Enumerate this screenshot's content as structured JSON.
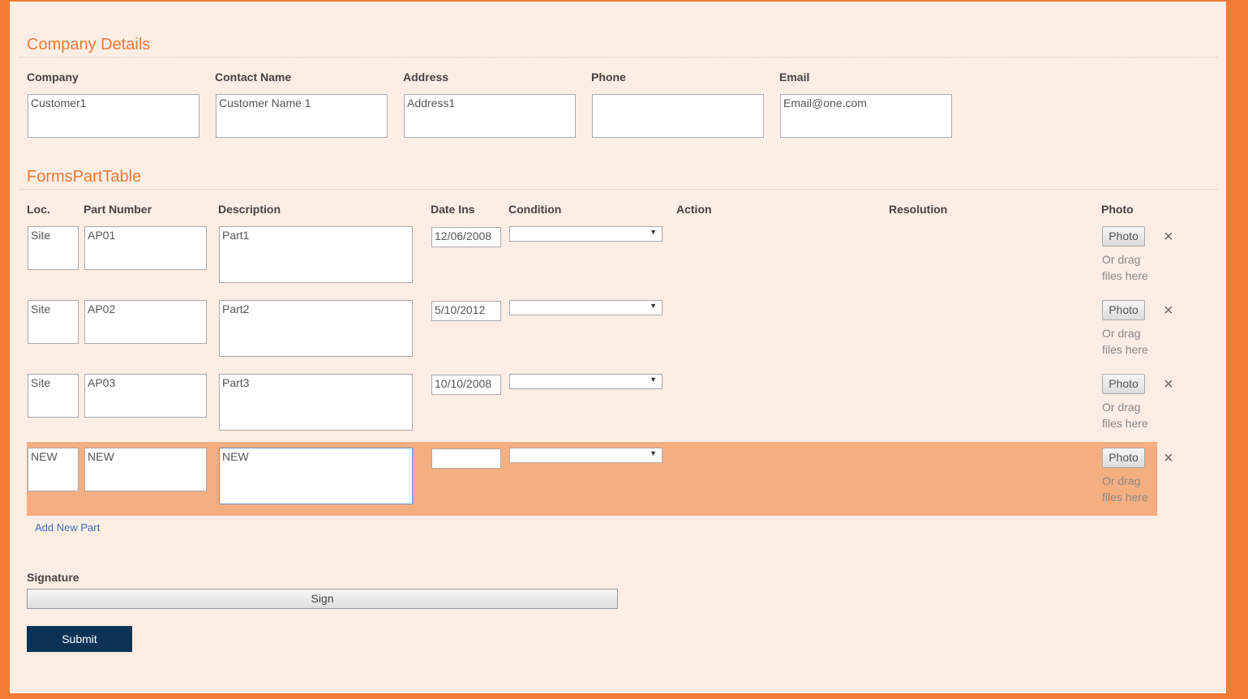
{
  "company_section": {
    "title": "Company Details",
    "fields": [
      {
        "label": "Company",
        "value": "Customer1"
      },
      {
        "label": "Contact Name",
        "value": "Customer Name 1"
      },
      {
        "label": "Address",
        "value": "Address1"
      },
      {
        "label": "Phone",
        "value": ""
      },
      {
        "label": "Email",
        "value": "Email@one.com"
      }
    ]
  },
  "parts_section": {
    "title": "FormsPartTable",
    "columns": [
      "Loc.",
      "Part Number",
      "Description",
      "Date Ins",
      "Condition",
      "Action",
      "Resolution",
      "Photo"
    ],
    "rows": [
      {
        "loc": "Site",
        "part": "AP01",
        "desc": "Part1",
        "date": "12/06/2008",
        "condition": ""
      },
      {
        "loc": "Site",
        "part": "AP02",
        "desc": "Part2",
        "date": "5/10/2012",
        "condition": ""
      },
      {
        "loc": "Site",
        "part": "AP03",
        "desc": "Part3",
        "date": "10/10/2008",
        "condition": ""
      },
      {
        "loc": "NEW",
        "part": "NEW",
        "desc": "NEW",
        "date": "",
        "condition": ""
      }
    ],
    "photo_button": "Photo",
    "drag_text_1": "Or drag",
    "drag_text_2": "files here",
    "remove_icon": "×",
    "add_link": "Add New Part"
  },
  "signature": {
    "label": "Signature",
    "button": "Sign"
  },
  "submit": "Submit",
  "colors": {
    "accent": "#f07b34",
    "background": "#fcede5",
    "highlight": "#f5ae80",
    "submit": "#0c3256"
  }
}
